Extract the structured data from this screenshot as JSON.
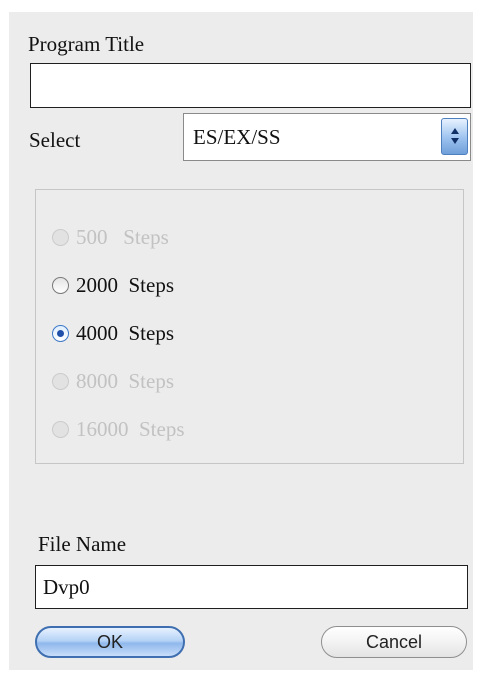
{
  "program_title": {
    "label": "Program Title",
    "value": ""
  },
  "select": {
    "label": "Select",
    "value": "ES/EX/SS"
  },
  "steps": [
    {
      "number": "500",
      "unit": "Steps",
      "enabled": false,
      "checked": false
    },
    {
      "number": "2000",
      "unit": "Steps",
      "enabled": true,
      "checked": false
    },
    {
      "number": "4000",
      "unit": "Steps",
      "enabled": true,
      "checked": true
    },
    {
      "number": "8000",
      "unit": "Steps",
      "enabled": false,
      "checked": false
    },
    {
      "number": "16000",
      "unit": "Steps",
      "enabled": false,
      "checked": false
    }
  ],
  "file_name": {
    "label": "File Name",
    "value": "Dvp0"
  },
  "buttons": {
    "ok": "OK",
    "cancel": "Cancel"
  },
  "colors": {
    "dialog_background": "#ececec",
    "accent_blue": "#3f78c8",
    "disabled_text": "#c2c2c2"
  }
}
